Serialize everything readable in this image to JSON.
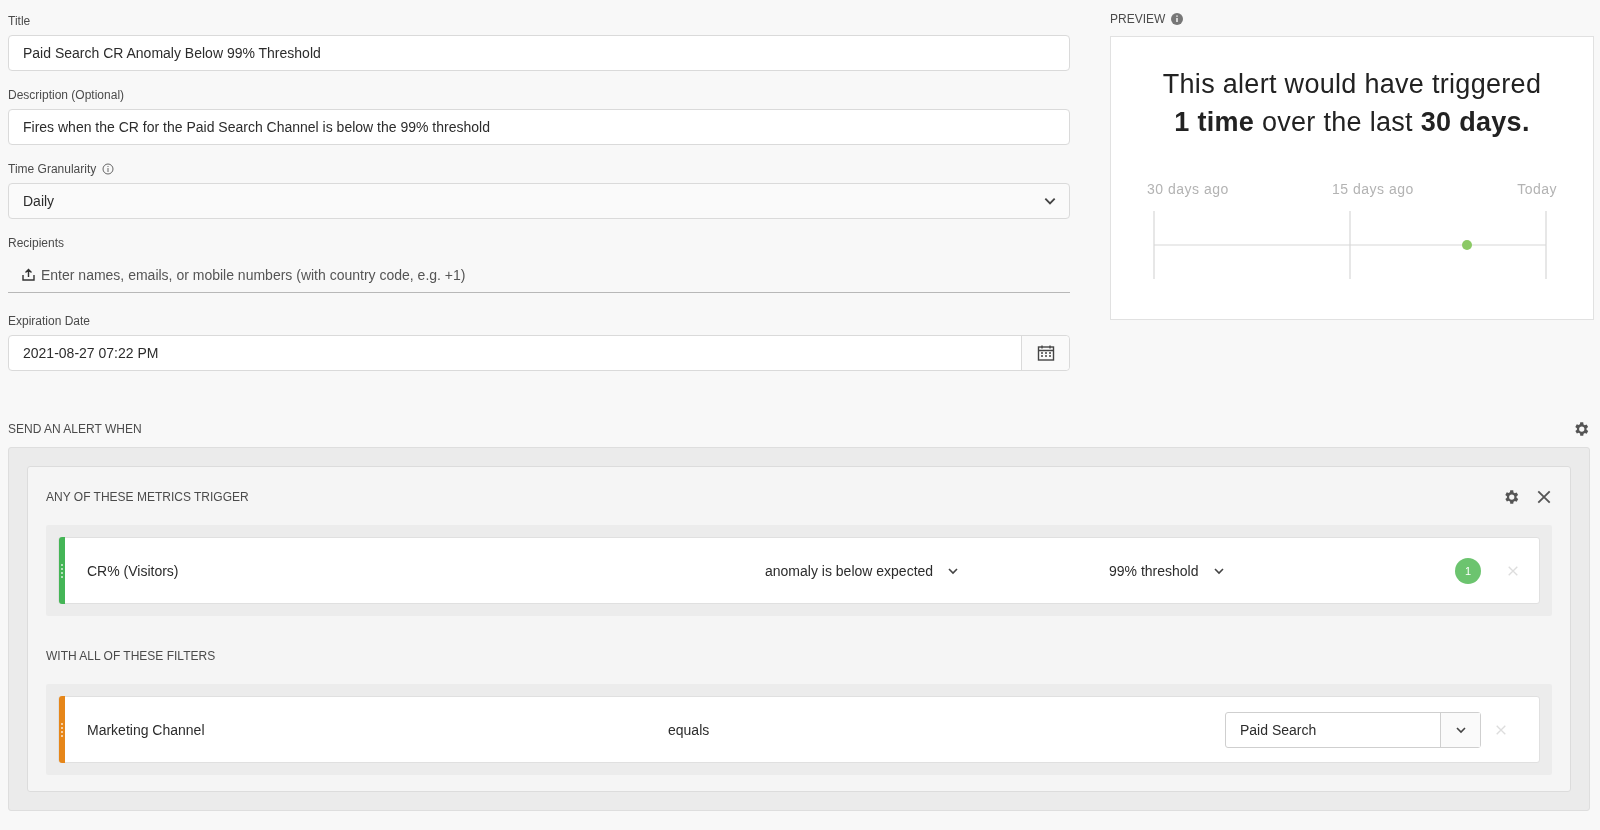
{
  "form": {
    "fields": [
      {
        "kind": "text",
        "label": "Title",
        "info": false,
        "value": "Paid Search CR Anomaly Below 99% Threshold"
      },
      {
        "kind": "text",
        "label": "Description (Optional)",
        "info": false,
        "value": "Fires when the CR for the Paid Search Channel is below the 99% threshold"
      },
      {
        "kind": "select",
        "label": "Time Granularity",
        "info": true,
        "value": "Daily"
      },
      {
        "kind": "recipients",
        "label": "Recipients",
        "info": false,
        "placeholder": "Enter names, emails, or mobile numbers (with country code, e.g. +1)"
      },
      {
        "kind": "date",
        "label": "Expiration Date",
        "info": false,
        "value": "2021-08-27 07:22 PM"
      }
    ]
  },
  "preview": {
    "title": "PREVIEW",
    "message_lines": [
      "This alert would have triggered",
      "**1 time** over the last **30 days.**"
    ],
    "timeline_labels": [
      "30 days ago",
      "15 days ago",
      "Today"
    ]
  },
  "conditions": {
    "heading": "SEND AN ALERT WHEN",
    "metrics": {
      "heading": "ANY OF THESE METRICS TRIGGER",
      "rows": [
        {
          "name": "CR% (Visitors)",
          "operator": "anomaly is below expected",
          "threshold": "99% threshold",
          "count": "1",
          "color": "#44b556"
        }
      ]
    },
    "filters": {
      "heading": "WITH ALL OF THESE FILTERS",
      "rows": [
        {
          "name": "Marketing Channel",
          "operator": "equals",
          "value": "Paid Search",
          "color": "#e68619"
        }
      ]
    }
  }
}
